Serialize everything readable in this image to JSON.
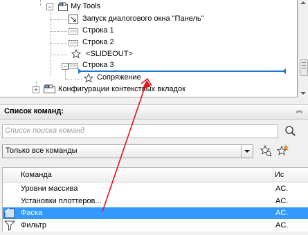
{
  "tree": {
    "items": [
      {
        "label": "My Tools"
      },
      {
        "label": "Запуск диалогового окна \"Панель\""
      },
      {
        "label": "Строка 1"
      },
      {
        "label": "Строка 2"
      },
      {
        "label": "<SLIDEOUT>"
      },
      {
        "label": "Строка 3"
      },
      {
        "label": "Сопряжение"
      },
      {
        "label": "Конфигурации контекстных вкладок"
      }
    ],
    "expander_plus": "+",
    "expander_minus": "−"
  },
  "commands": {
    "header_title": "Список команд:",
    "collapse_glyph": "︽",
    "search_placeholder": "Список поиска команд",
    "filter_value": "Только все команды",
    "columns": {
      "command": "Команда",
      "source": "Ис"
    },
    "rows": [
      {
        "name": "Уровни массива",
        "source": "AC.",
        "selected": false
      },
      {
        "name": "Установки плоттеров...",
        "source": "AC.",
        "selected": false
      },
      {
        "name": "Фаска",
        "source": "AC.",
        "selected": true
      },
      {
        "name": "Фильтр",
        "source": "AC.",
        "selected": false
      }
    ]
  },
  "colors": {
    "selection": "#3399ff",
    "drag_indicator": "#1e78d2",
    "annotation_arrow": "#e0141e"
  },
  "icons": [
    "ribbon-panel-icon",
    "dialog-launcher-icon",
    "row-icon",
    "slideout-star-icon",
    "command-star-icon",
    "tab-config-icon",
    "search-icon",
    "star-filter-icon",
    "star-new-icon",
    "chamfer-icon",
    "filter-funnel-icon"
  ]
}
